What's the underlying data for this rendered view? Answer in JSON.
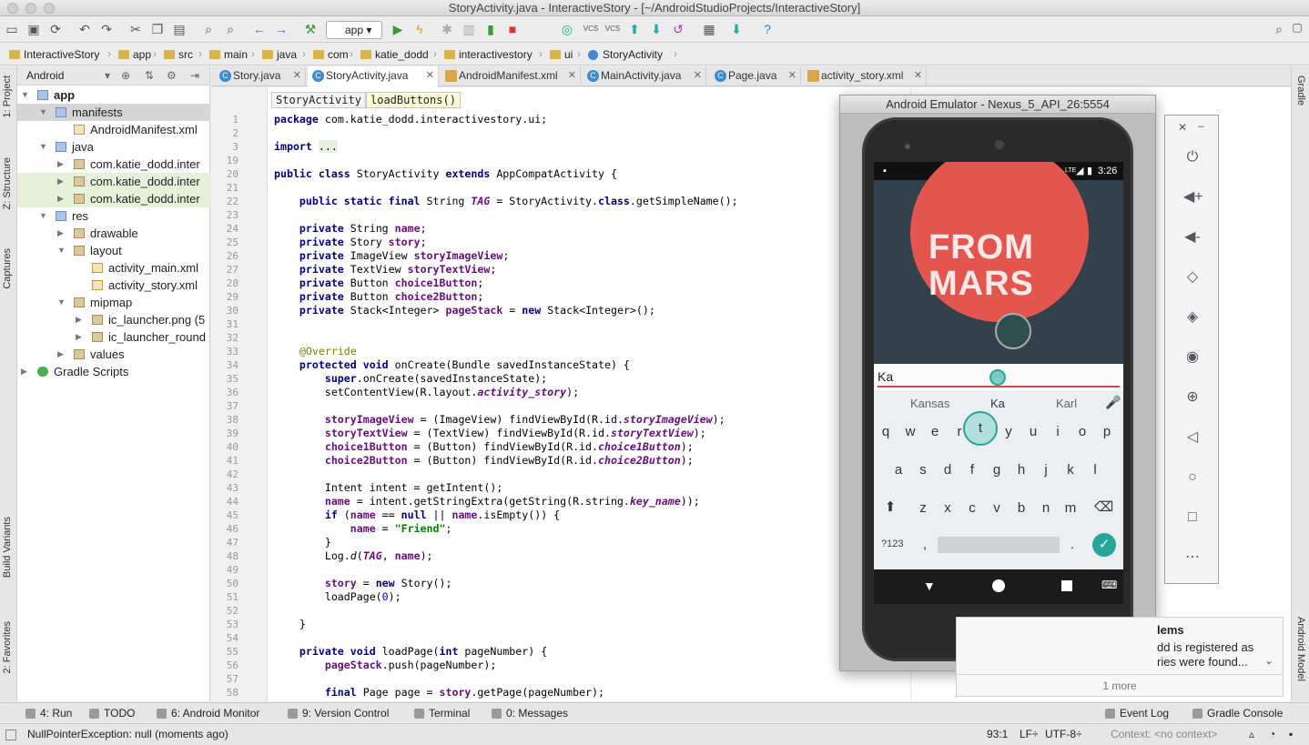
{
  "window_title": "StoryActivity.java - InteractiveStory - [~/AndroidStudioProjects/InteractiveStory]",
  "toolbar": {
    "run_config": "app"
  },
  "breadcrumb": [
    "InteractiveStory",
    "app",
    "src",
    "main",
    "java",
    "com",
    "katie_dodd",
    "interactivestory",
    "ui",
    "StoryActivity"
  ],
  "left_strip": {
    "project": "1: Project",
    "structure": "Z: Structure",
    "captures": "Captures",
    "build_variants": "Build Variants",
    "favorites": "2: Favorites"
  },
  "right_strip": {
    "gradle": "Gradle",
    "android_model": "Android Model"
  },
  "project_panel": {
    "view": "Android",
    "tree": [
      "app",
      "manifests",
      "AndroidManifest.xml",
      "java",
      "com.katie_dodd.inter",
      "com.katie_dodd.inter",
      "com.katie_dodd.inter",
      "res",
      "drawable",
      "layout",
      "activity_main.xml",
      "activity_story.xml",
      "mipmap",
      "ic_launcher.png (5",
      "ic_launcher_round",
      "values",
      "Gradle Scripts"
    ]
  },
  "tabs": [
    "Story.java",
    "StoryActivity.java",
    "AndroidManifest.xml",
    "MainActivity.java",
    "Page.java",
    "activity_story.xml"
  ],
  "editor": {
    "crumb_class": "StoryActivity",
    "crumb_method": "loadButtons()"
  },
  "emulator": {
    "title": "Android Emulator - Nexus_5_API_26:5554",
    "time": "3:26",
    "net": "LTE",
    "hero_text": "FROM MARS",
    "input_text": "Ka",
    "suggestions": [
      "Kansas",
      "Ka",
      "Karl"
    ],
    "keys_row1": [
      "q",
      "w",
      "e",
      "r",
      "t",
      "y",
      "u",
      "i",
      "o",
      "p"
    ],
    "keys_row2": [
      "a",
      "s",
      "d",
      "f",
      "g",
      "h",
      "j",
      "k",
      "l"
    ],
    "keys_row3": [
      "z",
      "x",
      "c",
      "v",
      "b",
      "n",
      "m"
    ],
    "symbols_key": "?123",
    "comma": ",",
    "period": "."
  },
  "notification": {
    "title": "lems",
    "line1": "dd is registered as",
    "line2": "ries were found...",
    "more": "1 more"
  },
  "bottom_tools": [
    "4: Run",
    "TODO",
    "6: Android Monitor",
    "9: Version Control",
    "Terminal",
    "0: Messages",
    "Event Log",
    "Gradle Console"
  ],
  "status": {
    "message": "NullPointerException: null (moments ago)",
    "position": "93:1",
    "line_sep": "LF÷",
    "encoding": "UTF-8÷",
    "context": "Context: <no context>"
  }
}
